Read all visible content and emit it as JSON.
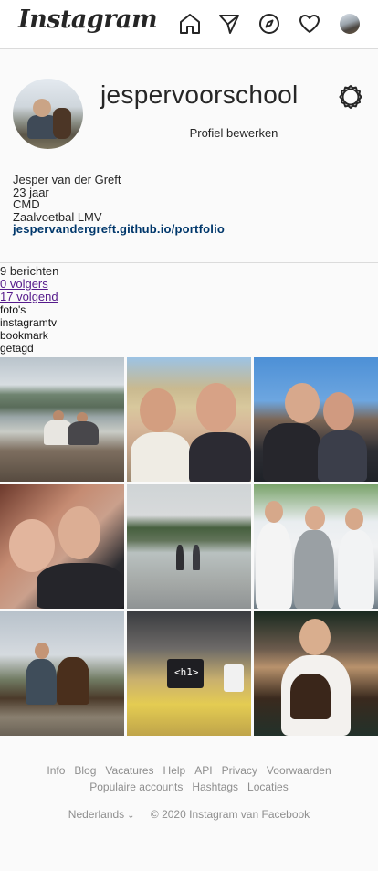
{
  "topbar": {
    "logo": "Instagram",
    "icons": [
      "home-icon",
      "direct-icon",
      "explore-icon",
      "activity-heart-icon",
      "profile-avatar"
    ]
  },
  "profile": {
    "username": "jespervoorschool",
    "edit_label": "Profiel bewerken",
    "bio": {
      "name": "Jesper van der Greft",
      "age": "23 jaar",
      "line3": "CMD",
      "line4": "Zaalvoetbal LMV",
      "link": "jespervandergreft.github.io/portfolio"
    }
  },
  "stats": {
    "posts": "9 berichten",
    "followers": "0 volgers",
    "following": "17 volgend"
  },
  "tabs": [
    "foto's",
    "instagramtv",
    "bookmark",
    "getagd"
  ],
  "footer": {
    "links": [
      "Info",
      "Blog",
      "Vacatures",
      "Help",
      "API",
      "Privacy",
      "Voorwaarden",
      "Populaire accounts",
      "Hashtags",
      "Locaties"
    ],
    "language": "Nederlands",
    "copyright": "© 2020 Instagram van Facebook"
  },
  "colors": {
    "link": "#00376b",
    "visited": "#551a8b",
    "muted": "#8e8e8e",
    "border": "#dbdbdb"
  }
}
